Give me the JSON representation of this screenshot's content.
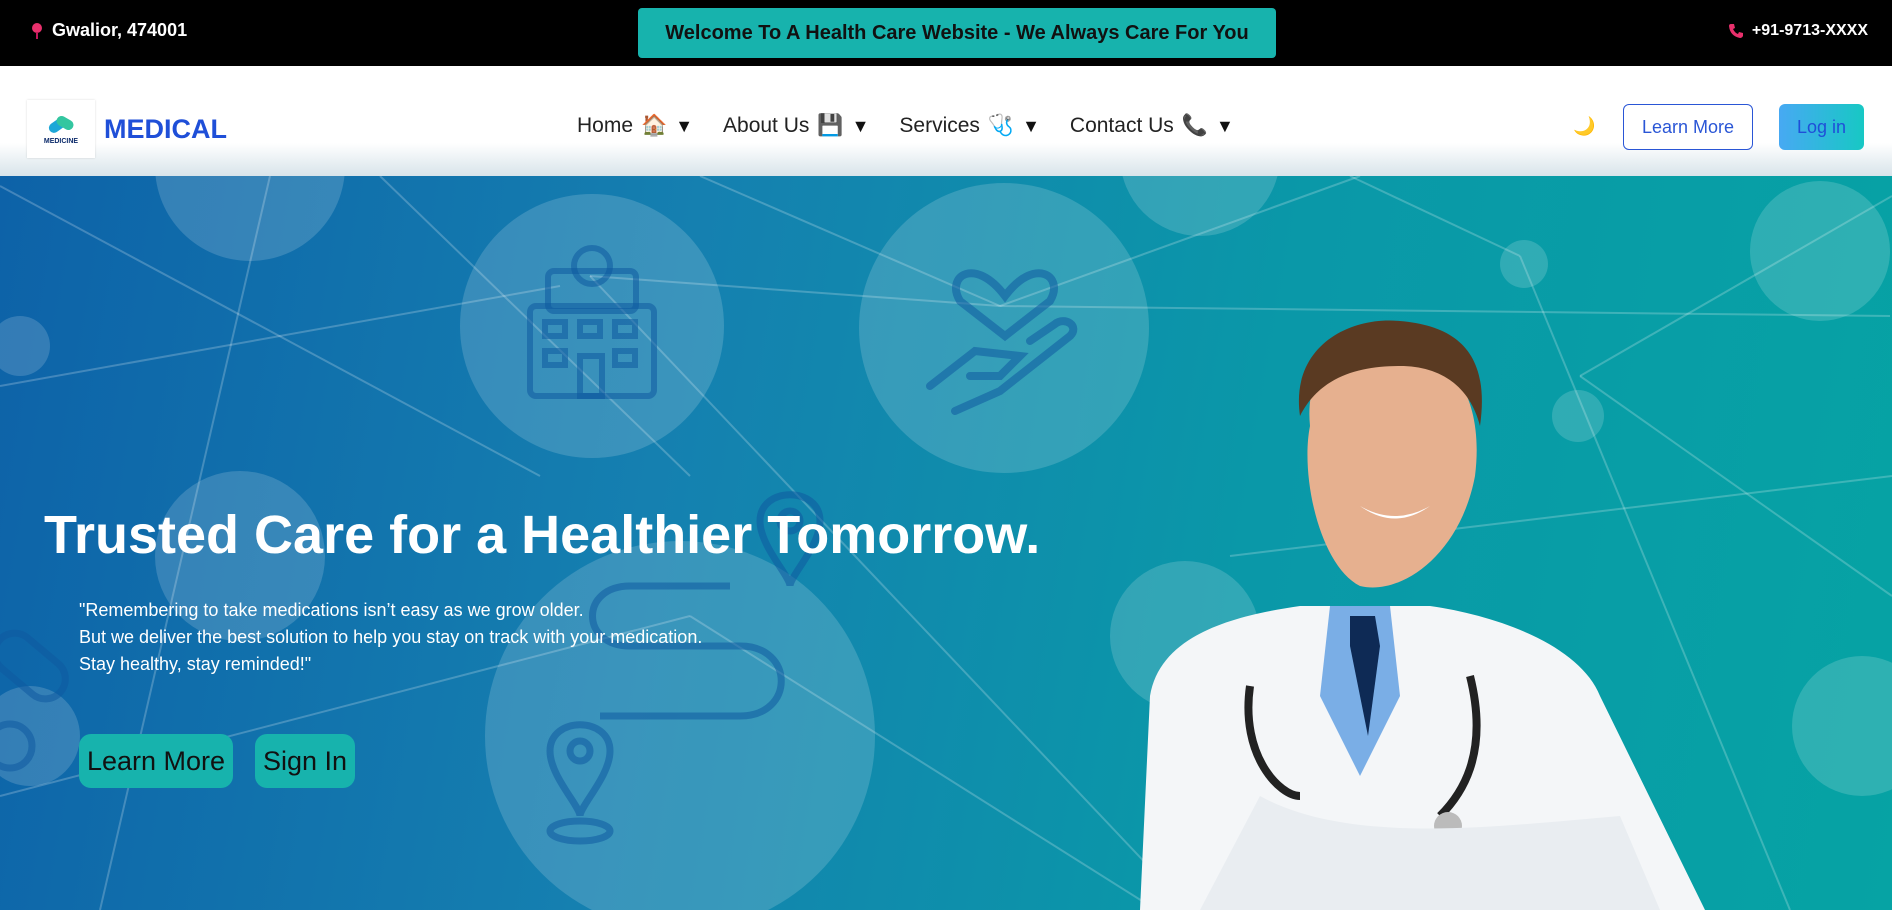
{
  "topbar": {
    "location": "Gwalior, 474001",
    "welcome": "Welcome To A Health Care Website - We Always Care For You",
    "phone": "+91-9713-XXXX"
  },
  "nav": {
    "logo_text": "MEDICINE",
    "brand": "MEDICAL",
    "items": [
      {
        "label": "Home",
        "emoji": "🏠"
      },
      {
        "label": "About Us",
        "emoji": "💾"
      },
      {
        "label": "Services",
        "emoji": "🩺"
      },
      {
        "label": "Contact Us",
        "emoji": "📞"
      }
    ],
    "caret": "▼",
    "theme_toggle": "🌙",
    "learn_more": "Learn More",
    "login": "Log in"
  },
  "hero": {
    "title": "Trusted Care for a Healthier Tomorrow.",
    "quote_lines": [
      "\"Remembering to take medications isn’t easy as we grow older.",
      "But we deliver the best solution to help you stay on track with your medication.",
      "Stay healthy, stay reminded!\""
    ],
    "learn_more": "Learn More",
    "sign_in": "Sign In"
  },
  "colors": {
    "accent_teal": "#17b3ad",
    "brand_blue": "#1f4fd8",
    "topbar_bg": "#000000"
  }
}
